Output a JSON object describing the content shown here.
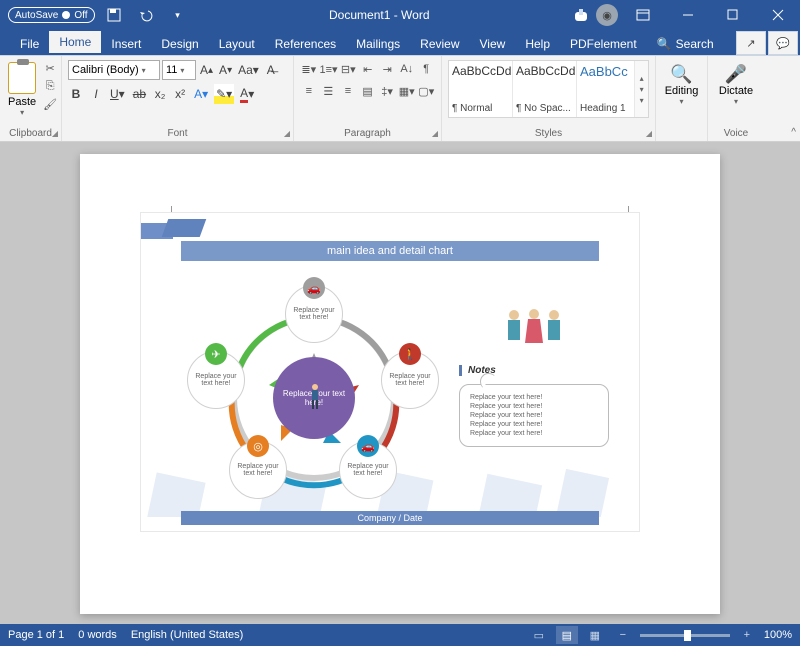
{
  "titlebar": {
    "autosave_label": "AutoSave",
    "autosave_state": "Off",
    "doc_title": "Document1 - Word"
  },
  "tabs": [
    "File",
    "Home",
    "Insert",
    "Design",
    "Layout",
    "References",
    "Mailings",
    "Review",
    "View",
    "Help",
    "PDFelement"
  ],
  "active_tab": "Home",
  "search_placeholder": "Search",
  "ribbon": {
    "clipboard": {
      "paste": "Paste",
      "label": "Clipboard"
    },
    "font": {
      "family": "Calibri (Body)",
      "size": "11",
      "label": "Font"
    },
    "paragraph": {
      "label": "Paragraph"
    },
    "styles": {
      "label": "Styles",
      "items": [
        {
          "preview": "AaBbCcDd",
          "name": "¶ Normal"
        },
        {
          "preview": "AaBbCcDd",
          "name": "¶ No Spac..."
        },
        {
          "preview": "AaBbCc",
          "name": "Heading 1"
        }
      ]
    },
    "editing": {
      "label": "Editing"
    },
    "voice": {
      "dictate": "Dictate",
      "label": "Voice"
    }
  },
  "document": {
    "chart_title": "main idea and detail chart",
    "center_text": "Replace your text here!",
    "node_text": "Replace your text here!",
    "notes_heading": "Notes",
    "notes_lines": [
      "Replace your text here!",
      "Replace your text here!",
      "Replace your text here!",
      "Replace your text here!",
      "Replace your text here!"
    ],
    "footer_text": "Company / Date"
  },
  "status": {
    "page": "Page 1 of 1",
    "words": "0 words",
    "language": "English (United States)",
    "zoom": "100%"
  }
}
